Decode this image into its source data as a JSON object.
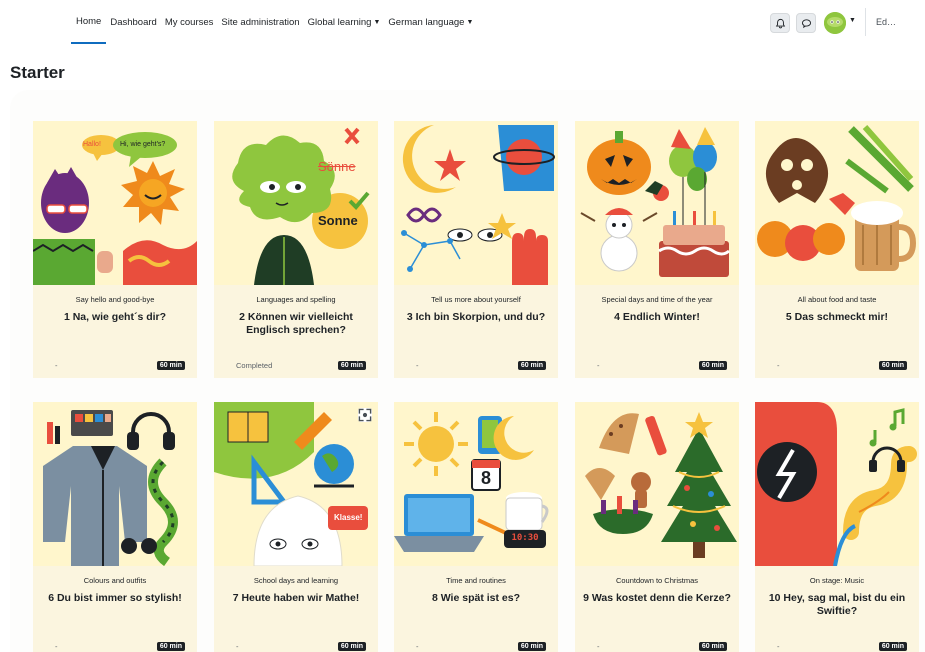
{
  "nav": {
    "links": [
      {
        "label": "Home",
        "active": true
      },
      {
        "label": "Dashboard",
        "active": false
      },
      {
        "label": "My courses",
        "active": false
      },
      {
        "label": "Site administration",
        "active": false
      }
    ],
    "dropdowns": [
      {
        "label": "Global learning"
      },
      {
        "label": "German language"
      }
    ],
    "edit_mode_label": "Ed…"
  },
  "page": {
    "title": "Starter"
  },
  "cards": [
    {
      "category": "Say hello and good-bye",
      "title": "1 Na, wie geht´s dir?",
      "status": "-",
      "duration": "60 min",
      "speech1": "Hallo!",
      "speech2": "Hi, wie geht's?"
    },
    {
      "category": "Languages and spelling",
      "title": "2 Können wir vielleicht Englisch sprechen?",
      "status": "Completed",
      "duration": "60 min",
      "word_wrong": "Sönne",
      "word_right": "Sonne"
    },
    {
      "category": "Tell us more about yourself",
      "title": "3 Ich bin Skorpion, und du?",
      "status": "-",
      "duration": "60 min"
    },
    {
      "category": "Special days and time of the year",
      "title": "4 Endlich Winter!",
      "status": "-",
      "duration": "60 min"
    },
    {
      "category": "All about food and taste",
      "title": "5 Das schmeckt mir!",
      "status": "-",
      "duration": "60 min"
    },
    {
      "category": "Colours and outfits",
      "title": "6 Du bist immer so stylish!",
      "status": "-",
      "duration": "60 min"
    },
    {
      "category": "School days and learning",
      "title": "7 Heute haben wir Mathe!",
      "status": "-",
      "duration": "60 min",
      "speech": "Klasse!"
    },
    {
      "category": "Time and routines",
      "title": "8 Wie spät ist es?",
      "status": "-",
      "duration": "60 min",
      "calendar": "8",
      "clock": "10:30"
    },
    {
      "category": "Countdown to Christmas",
      "title": "9 Was kostet denn die Kerze?",
      "status": "-",
      "duration": "60 min"
    },
    {
      "category": "On stage: Music",
      "title": "10 Hey, sag mal, bist du ein Swiftie?",
      "status": "-",
      "duration": "60 min"
    }
  ],
  "colors": {
    "accent": "#0f6cbf",
    "card_bg": "#fbf5df",
    "image_bg": "#fff6cc",
    "badge_bg": "#1d2125"
  }
}
